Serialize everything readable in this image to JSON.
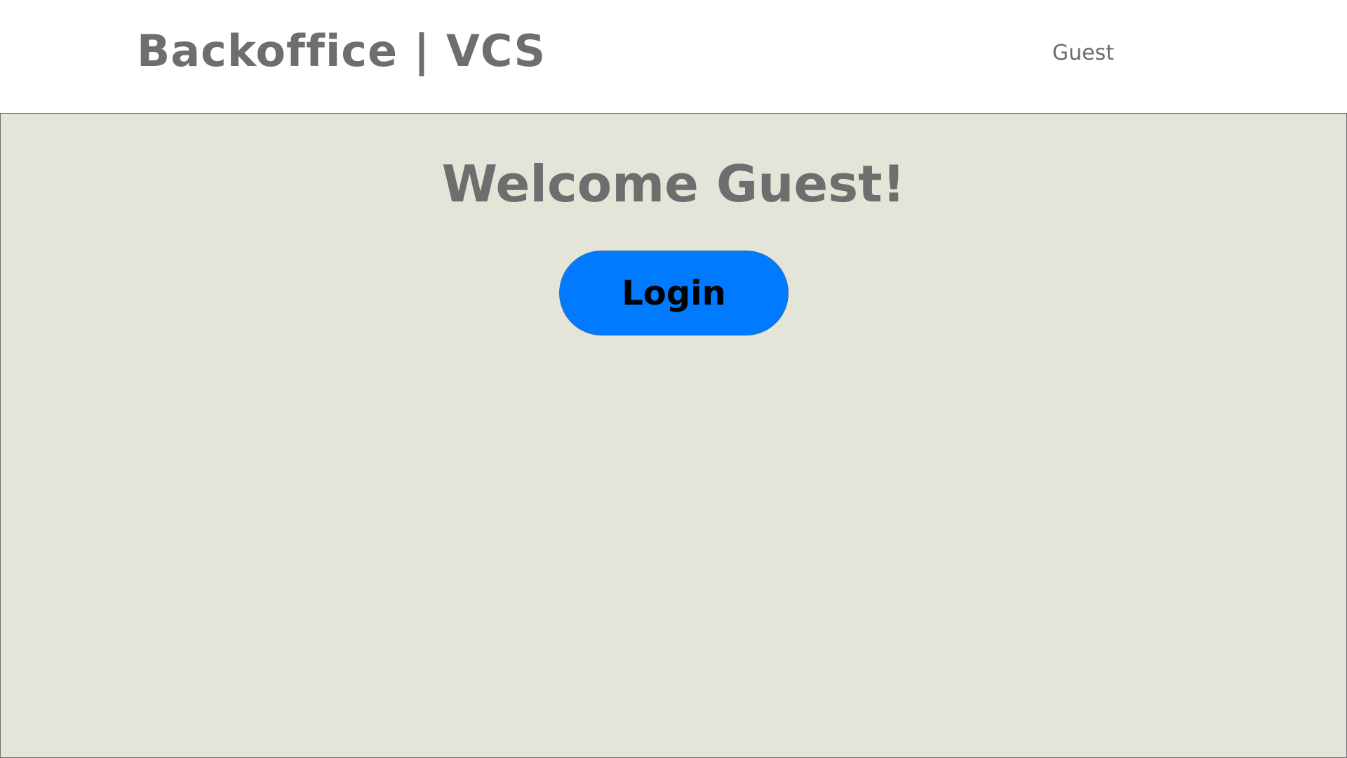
{
  "header": {
    "brand": "Backoffice | VCS",
    "user": "Guest"
  },
  "main": {
    "welcome": "Welcome Guest!",
    "login_label": "Login"
  },
  "colors": {
    "text_gray": "#6e6e6e",
    "main_background": "#e4e5d8",
    "button_blue": "#007bff"
  }
}
